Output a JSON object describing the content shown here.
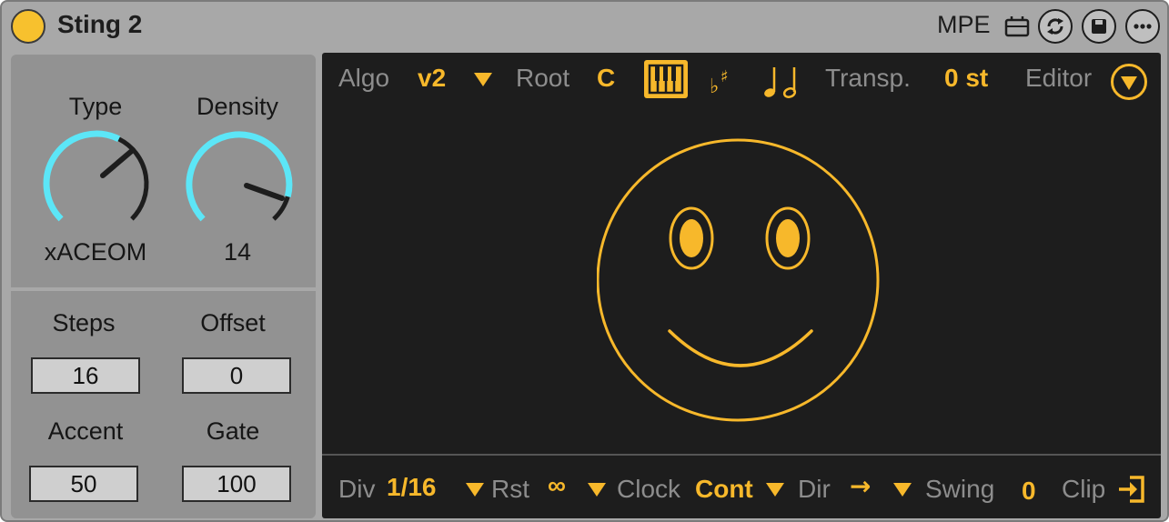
{
  "device": {
    "title": "Sting 2",
    "mpe_label": "MPE"
  },
  "header_icons": [
    "mpe-toggle-icon",
    "refresh-icon",
    "save-icon",
    "more-icon"
  ],
  "left": {
    "knobs": [
      {
        "label": "Type",
        "value": "xACEOM"
      },
      {
        "label": "Density",
        "value": "14"
      }
    ],
    "numbers": [
      {
        "label": "Steps",
        "value": "16"
      },
      {
        "label": "Offset",
        "value": "0"
      },
      {
        "label": "Accent",
        "value": "50"
      },
      {
        "label": "Gate",
        "value": "100"
      }
    ]
  },
  "top_bar": {
    "algo_label": "Algo",
    "algo_value": "v2",
    "root_label": "Root",
    "root_value": "C",
    "transp_label": "Transp.",
    "transp_value": "0 st",
    "editor_label": "Editor"
  },
  "bottom_bar": {
    "div_label": "Div",
    "div_value": "1/16",
    "rst_label": "Rst",
    "rst_value": "∞",
    "clock_label": "Clock",
    "clock_value": "Cont",
    "dir_label": "Dir",
    "dir_value": "→",
    "swing_label": "Swing",
    "swing_value": "0",
    "clip_label": "Clip"
  },
  "colors": {
    "accent": "#f7b82b",
    "knob_arc": "#5ce6f7",
    "display_bg": "#1d1d1d",
    "panel_bg": "#929292"
  }
}
